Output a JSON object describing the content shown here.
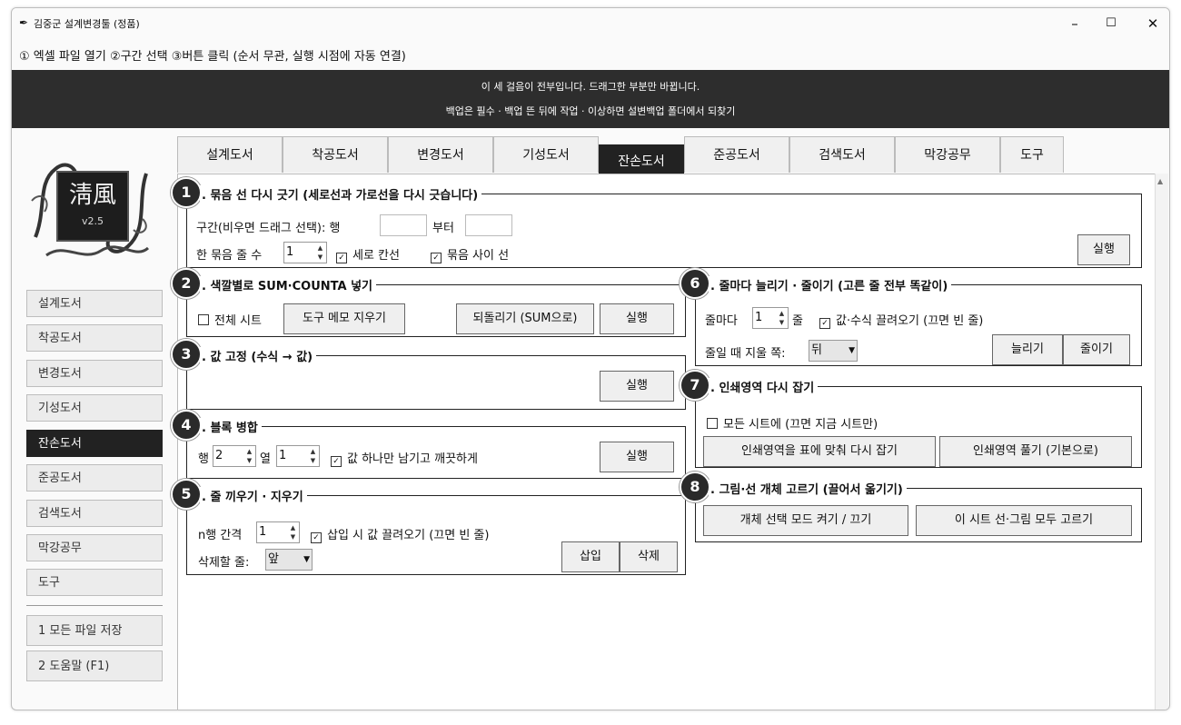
{
  "window": {
    "title": "김중군 설계변경툴 (정품)",
    "controls": {
      "minimize": "–",
      "maximize": "☐",
      "close": "✕"
    }
  },
  "hint": "① 엑셀 파일 열기 ②구간 선택 ③버튼 클릭 (순서 무관, 실행 시점에 자동 연결)",
  "banner": {
    "line1": "이 세 걸음이 전부입니다. 드래그한 부분만 바뀝니다.",
    "line2": "백업은 필수 · 백업 뜬 뒤에 작업 · 이상하면 설변백업 폴더에서 되찾기"
  },
  "logo": {
    "char": "淸風",
    "version": "v2.5"
  },
  "tabs": [
    "설계도서",
    "착공도서",
    "변경도서",
    "기성도서",
    "잔손도서",
    "준공도서",
    "검색도서",
    "막강공무",
    "도구"
  ],
  "active_tab": "잔손도서",
  "sidebar": {
    "items": [
      "설계도서",
      "착공도서",
      "변경도서",
      "기성도서",
      "잔손도서",
      "준공도서",
      "검색도서",
      "막강공무",
      "도구"
    ],
    "active": "잔손도서",
    "footer": [
      "1 모든 파일 저장",
      "2 도움말 (F1)"
    ]
  },
  "groups": {
    "g1": {
      "num": "1",
      "title": ". 묶음 선 다시 긋기  (세로선과 가로선을 다시 긋습니다)",
      "range_label": "구간(비우면 드래그 선택): 행",
      "from_label": "부터",
      "row_from": "",
      "row_to": "",
      "rows_label": "한 묶음 줄 수",
      "rows_value": "1",
      "chk_vertical": "세로 칸선",
      "chk_between": "묶음 사이 선",
      "run": "실행"
    },
    "g2": {
      "num": "2",
      "title": ". 색깔별로 SUM·COUNTA 넣기",
      "chk_all": "전체 시트",
      "clear_memo": "도구 메모 지우기",
      "revert": "되돌리기 (SUM으로)",
      "run": "실행"
    },
    "g3": {
      "num": "3",
      "title": ". 값 고정  (수식 → 값)",
      "run": "실행"
    },
    "g4": {
      "num": "4",
      "title": ". 블록 병합",
      "row_label": "행",
      "row_value": "2",
      "col_label": "열",
      "col_value": "1",
      "chk_keep": "값 하나만 남기고 깨끗하게",
      "run": "실행"
    },
    "g5": {
      "num": "5",
      "title": ". 줄 끼우기 · 지우기",
      "interval_label": "n행 간격",
      "interval_value": "1",
      "chk_pull": "삽입 시 값 끌려오기 (끄면 빈 줄)",
      "delete_label": "삭제할 줄:",
      "delete_value": "앞",
      "insert": "삽입",
      "delete": "삭제"
    },
    "g6": {
      "num": "6",
      "title": ". 줄마다 늘리기 · 줄이기  (고른 줄 전부 똑같이)",
      "every_label": "줄마다",
      "every_value": "1",
      "unit": "줄",
      "chk_formula": "값·수식 끌려오기 (끄면 빈 줄)",
      "remove_label": "줄일 때 지울 쪽:",
      "remove_value": "뒤",
      "increase": "늘리기",
      "decrease": "줄이기"
    },
    "g7": {
      "num": "7",
      "title": ". 인쇄영역 다시 잡기",
      "chk_all_sheets": "모든 시트에 (끄면 지금 시트만)",
      "fit": "인쇄영역을 표에 맞춰 다시 잡기",
      "release": "인쇄영역 풀기 (기본으로)"
    },
    "g8": {
      "num": "8",
      "title": ". 그림·선 개체 고르기  (끌어서 옮기기)",
      "toggle_mode": "개체 선택 모드 켜기 / 끄기",
      "select_all": "이 시트 선·그림 모두 고르기"
    }
  }
}
